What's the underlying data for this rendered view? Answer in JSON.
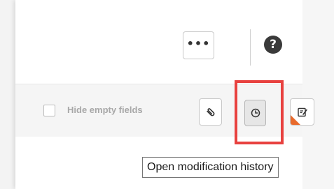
{
  "header": {
    "more_label": "•••",
    "help_label": "?"
  },
  "toolbar": {
    "hide_empty_fields_label": "Hide empty fields",
    "hide_empty_fields_checked": false,
    "buttons": [
      {
        "icon": "paperclip-icon"
      },
      {
        "icon": "clock-icon"
      },
      {
        "icon": "notes-icon"
      }
    ]
  },
  "tooltip": {
    "text": "Open modification history"
  },
  "colors": {
    "highlight": "#e8413f",
    "notes_accent": "#e86a2c",
    "help_bg": "#3a3a3a"
  }
}
